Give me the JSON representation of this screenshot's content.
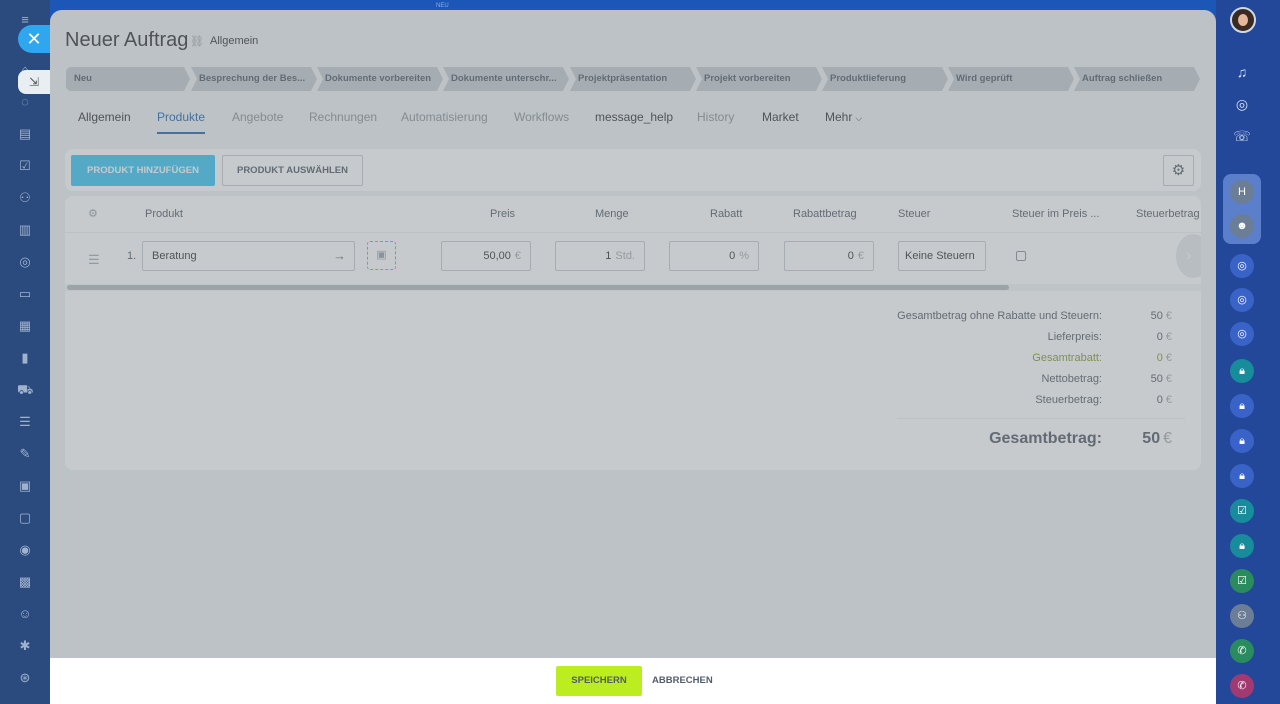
{
  "header": {
    "title": "Neuer Auftrag",
    "subtitle": "Allgemein",
    "top_hint": "NEU"
  },
  "stages": [
    "Neu",
    "Besprechung der Bes...",
    "Dokumente vorbereiten",
    "Dokumente unterschr...",
    "Projektpräsentation",
    "Projekt vorbereiten",
    "Produktlieferung",
    "Wird geprüft",
    "Auftrag schließen"
  ],
  "tabs": [
    {
      "label": "Allgemein",
      "state": "normal"
    },
    {
      "label": "Produkte",
      "state": "active"
    },
    {
      "label": "Angebote",
      "state": "muted"
    },
    {
      "label": "Rechnungen",
      "state": "muted"
    },
    {
      "label": "Automatisierung",
      "state": "muted"
    },
    {
      "label": "Workflows",
      "state": "muted"
    },
    {
      "label": "message_help",
      "state": "normal"
    },
    {
      "label": "History",
      "state": "muted"
    },
    {
      "label": "Market",
      "state": "normal"
    },
    {
      "label": "Mehr",
      "state": "normal"
    }
  ],
  "toolbar": {
    "add_label": "PRODUKT HINZUFÜGEN",
    "select_label": "PRODUKT AUSWÄHLEN"
  },
  "table": {
    "columns": [
      "Produkt",
      "Preis",
      "Menge",
      "Rabatt",
      "Rabattbetrag",
      "Steuer",
      "Steuer im Preis ...",
      "Steuerbetrag"
    ],
    "rows": [
      {
        "index": "1.",
        "product": "Beratung",
        "price": "50,00",
        "price_unit": "€",
        "quantity": "1",
        "quantity_unit": "Std.",
        "discount": "0",
        "discount_unit": "%",
        "discount_amount": "0",
        "discount_amount_unit": "€",
        "tax": "Keine Steuern",
        "tax_included": false
      }
    ]
  },
  "summary": {
    "currency": "€",
    "lines": [
      {
        "label": "Gesamtbetrag ohne Rabatte und Steuern:",
        "value": "50"
      },
      {
        "label": "Lieferpreis:",
        "value": "0"
      },
      {
        "label": "Gesamtrabatt:",
        "value": "0"
      },
      {
        "label": "Nettobetrag:",
        "value": "50"
      },
      {
        "label": "Steuerbetrag:",
        "value": "0"
      }
    ],
    "total_label": "Gesamtbetrag:",
    "total_value": "50"
  },
  "footer": {
    "save_label": "SPEICHERN",
    "cancel_label": "ABBRECHEN"
  },
  "right_rail": {
    "group_initial": "H"
  },
  "colors": {
    "accent_blue": "#3bc8f5",
    "save_green": "#bbed21",
    "discount_green": "#80a11e",
    "active_tab": "#2066b0"
  }
}
